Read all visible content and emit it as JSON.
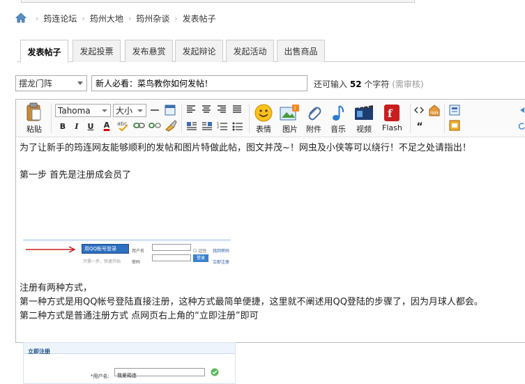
{
  "breadcrumb": {
    "items": [
      "筠连论坛",
      "筠州大地",
      "筠州杂谈",
      "发表帖子"
    ]
  },
  "tabs": [
    "发表帖子",
    "发起投票",
    "发布悬赏",
    "发起辩论",
    "发起活动",
    "出售商品"
  ],
  "form": {
    "category": "摆龙门阵",
    "subject": "新人必看：菜鸟教你如何发帖！",
    "hint_prefix": "还可输入",
    "hint_count": "52",
    "hint_suffix": "个字符",
    "hint_review": "(需审核)"
  },
  "toolbar": {
    "paste": "粘贴",
    "font": "Tahoma",
    "size": "大小",
    "bold": "B",
    "italic": "I",
    "underline": "U",
    "fontcolor": "A",
    "emoji": "表情",
    "image": "图片",
    "attach": "附件",
    "music": "音乐",
    "video": "视频",
    "flash": "Flash",
    "quote": "“"
  },
  "content": {
    "line1": "为了让新手的筠连网友能够顺利的发帖和图片特做此帖，图文并茂~！网虫及小侠等可以绕行！不足之处请指出！",
    "line2": "第一步  首先是注册成会员了",
    "line3": "注册有两种方式，",
    "line4": "第一种方式是用QQ帐号登陆直接注册，这种方式最简单便捷，这里就不阐述用QQ登陆的步骤了，因为月球人都会。",
    "line5": "第二种方式是普通注册方式  点网页右上角的“立即注册”即可"
  },
  "shot1": {
    "qq_button": "用QQ帐号登录",
    "qq_sub": "只需一步，快速开始",
    "user_label": "用户名",
    "pass_label": "密码",
    "remember": "记住",
    "forgot": "找回密码",
    "login": "登录",
    "register": "立即注册"
  },
  "shot2": {
    "header": "立即注册",
    "username_label": "*用户名:",
    "username_value": "我爱筠连"
  },
  "colors": {
    "accent": "#1a64b4",
    "tab_border": "#cccccc"
  }
}
